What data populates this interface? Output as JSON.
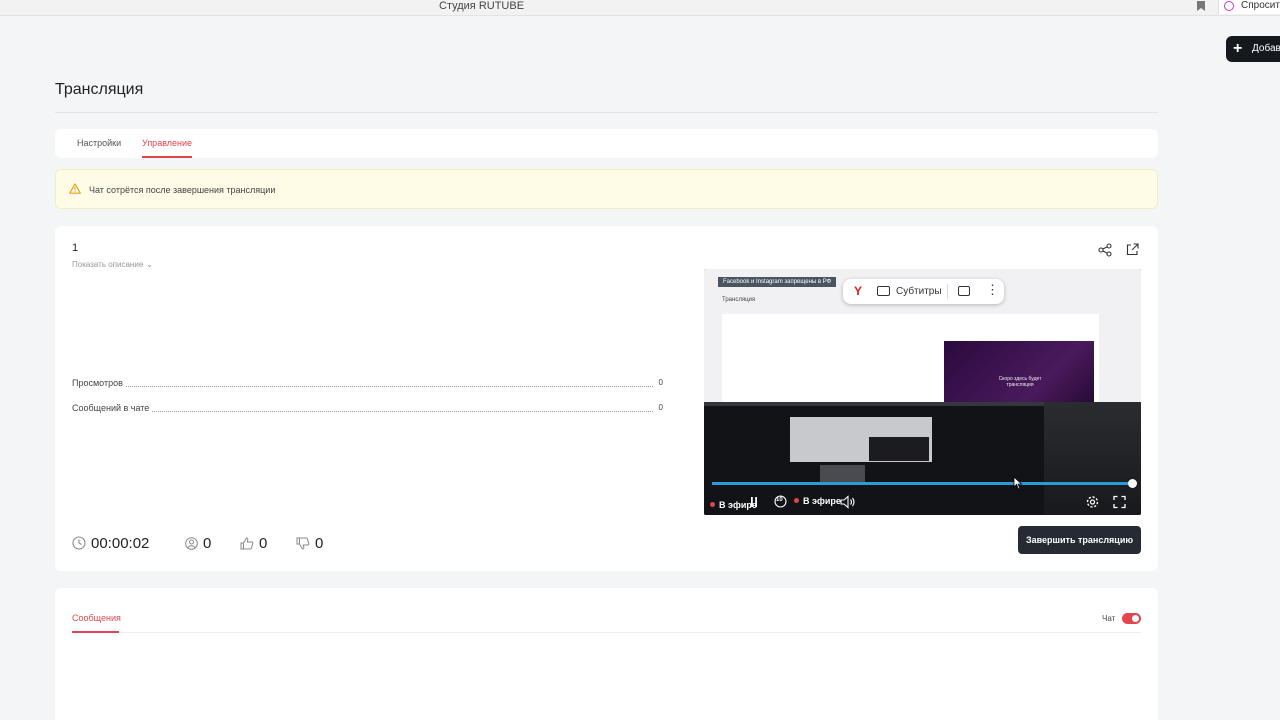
{
  "browser": {
    "tab_title": "Студия RUTUBE",
    "ask_label": "Спросить"
  },
  "header": {
    "add_button": "Добав"
  },
  "page": {
    "title": "Трансляция"
  },
  "tabs": [
    {
      "label": "Настройки",
      "active": false
    },
    {
      "label": "Управление",
      "active": true
    }
  ],
  "warning": {
    "text": "Чат сотрётся после завершения трансляции"
  },
  "stream": {
    "name": "1",
    "show_description": "Показать описание",
    "stats": [
      {
        "label": "Просмотров",
        "value": "0"
      },
      {
        "label": "Сообщений в чате",
        "value": "0"
      }
    ],
    "duration": "00:00:02",
    "viewers": "0",
    "likes": "0",
    "dislikes": "0",
    "end_button": "Завершить трансляцию"
  },
  "player": {
    "banner": "Facebook и Instagram запрещены в РФ",
    "inner_title": "Трансляция",
    "inner_preview_text": "Скоро здесь будет трансляция",
    "subtitles_label": "Субтитры",
    "live_label_left": "В эфире",
    "live_label_right": "В эфире",
    "skip_seconds": "10",
    "progress": 1.0
  },
  "messages": {
    "tab_label": "Сообщения",
    "chat_label": "Чат",
    "chat_enabled": true
  },
  "colors": {
    "accent": "#e2454e",
    "progress": "#2a9bd6",
    "dark_button": "#262b33"
  }
}
